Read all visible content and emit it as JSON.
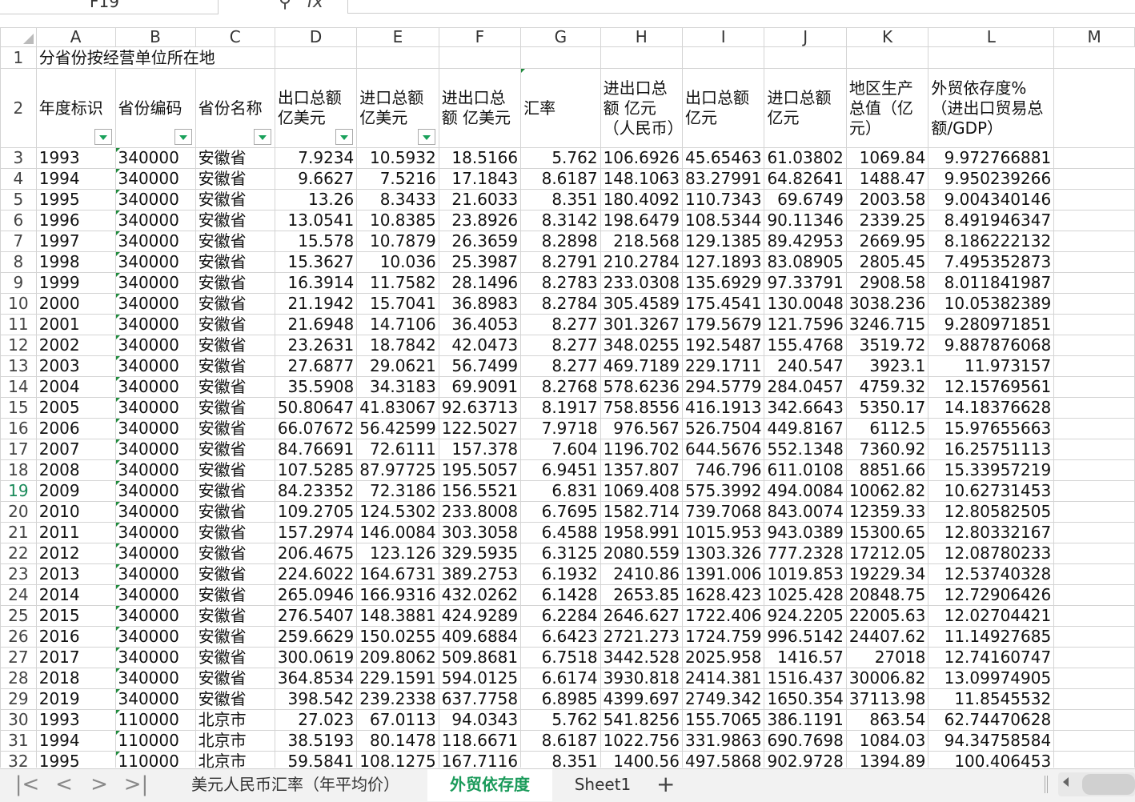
{
  "formula_bar": {
    "name_box": "F19",
    "fx": "fx",
    "content": ""
  },
  "columns": [
    "A",
    "B",
    "C",
    "D",
    "E",
    "F",
    "G",
    "H",
    "I",
    "J",
    "K",
    "L",
    "M"
  ],
  "row1": {
    "num": "1",
    "title": "分省份按经营单位所在地"
  },
  "headers": {
    "num": "2",
    "cells": [
      "年度标识",
      "省份编码",
      "省份名称",
      "出口总额 亿美元",
      "进口总额 亿美元",
      "进出口总额 亿美元",
      "汇率",
      "进出口总额 亿元（人民币）",
      "出口总额 亿元",
      "进口总额 亿元",
      "地区生产总值（亿元）",
      "外贸依存度%（进出口贸易总额/GDP）",
      ""
    ]
  },
  "rows": [
    [
      "3",
      "1993",
      "340000",
      "安徽省",
      "7.9234",
      "10.5932",
      "18.5166",
      "5.762",
      "106.6926",
      "45.65463",
      "61.03802",
      "1069.84",
      "9.972766881"
    ],
    [
      "4",
      "1994",
      "340000",
      "安徽省",
      "9.6627",
      "7.5216",
      "17.1843",
      "8.6187",
      "148.1063",
      "83.27991",
      "64.82641",
      "1488.47",
      "9.950239266"
    ],
    [
      "5",
      "1995",
      "340000",
      "安徽省",
      "13.26",
      "8.3433",
      "21.6033",
      "8.351",
      "180.4092",
      "110.7343",
      "69.6749",
      "2003.58",
      "9.004340146"
    ],
    [
      "6",
      "1996",
      "340000",
      "安徽省",
      "13.0541",
      "10.8385",
      "23.8926",
      "8.3142",
      "198.6479",
      "108.5344",
      "90.11346",
      "2339.25",
      "8.491946347"
    ],
    [
      "7",
      "1997",
      "340000",
      "安徽省",
      "15.578",
      "10.7879",
      "26.3659",
      "8.2898",
      "218.568",
      "129.1385",
      "89.42953",
      "2669.95",
      "8.186222132"
    ],
    [
      "8",
      "1998",
      "340000",
      "安徽省",
      "15.3627",
      "10.036",
      "25.3987",
      "8.2791",
      "210.2784",
      "127.1893",
      "83.08905",
      "2805.45",
      "7.495352873"
    ],
    [
      "9",
      "1999",
      "340000",
      "安徽省",
      "16.3914",
      "11.7582",
      "28.1496",
      "8.2783",
      "233.0308",
      "135.6929",
      "97.33791",
      "2908.58",
      "8.011841987"
    ],
    [
      "10",
      "2000",
      "340000",
      "安徽省",
      "21.1942",
      "15.7041",
      "36.8983",
      "8.2784",
      "305.4589",
      "175.4541",
      "130.0048",
      "3038.236",
      "10.05382389"
    ],
    [
      "11",
      "2001",
      "340000",
      "安徽省",
      "21.6948",
      "14.7106",
      "36.4053",
      "8.277",
      "301.3267",
      "179.5679",
      "121.7596",
      "3246.715",
      "9.280971851"
    ],
    [
      "12",
      "2002",
      "340000",
      "安徽省",
      "23.2631",
      "18.7842",
      "42.0473",
      "8.277",
      "348.0255",
      "192.5487",
      "155.4768",
      "3519.72",
      "9.887876068"
    ],
    [
      "13",
      "2003",
      "340000",
      "安徽省",
      "27.6877",
      "29.0621",
      "56.7499",
      "8.277",
      "469.7189",
      "229.1711",
      "240.547",
      "3923.1",
      "11.973157"
    ],
    [
      "14",
      "2004",
      "340000",
      "安徽省",
      "35.5908",
      "34.3183",
      "69.9091",
      "8.2768",
      "578.6236",
      "294.5779",
      "284.0457",
      "4759.32",
      "12.15769561"
    ],
    [
      "15",
      "2005",
      "340000",
      "安徽省",
      "50.80647",
      "41.83067",
      "92.63713",
      "8.1917",
      "758.8556",
      "416.1913",
      "342.6643",
      "5350.17",
      "14.18376628"
    ],
    [
      "16",
      "2006",
      "340000",
      "安徽省",
      "66.07672",
      "56.42599",
      "122.5027",
      "7.9718",
      "976.567",
      "526.7504",
      "449.8167",
      "6112.5",
      "15.97655663"
    ],
    [
      "17",
      "2007",
      "340000",
      "安徽省",
      "84.76691",
      "72.6111",
      "157.378",
      "7.604",
      "1196.702",
      "644.5676",
      "552.1348",
      "7360.92",
      "16.25751113"
    ],
    [
      "18",
      "2008",
      "340000",
      "安徽省",
      "107.5285",
      "87.97725",
      "195.5057",
      "6.9451",
      "1357.807",
      "746.796",
      "611.0108",
      "8851.66",
      "15.33957219"
    ],
    [
      "19",
      "2009",
      "340000",
      "安徽省",
      "84.23352",
      "72.3186",
      "156.5521",
      "6.831",
      "1069.408",
      "575.3992",
      "494.0084",
      "10062.82",
      "10.62731453"
    ],
    [
      "20",
      "2010",
      "340000",
      "安徽省",
      "109.2705",
      "124.5302",
      "233.8008",
      "6.7695",
      "1582.714",
      "739.7068",
      "843.0074",
      "12359.33",
      "12.80582505"
    ],
    [
      "21",
      "2011",
      "340000",
      "安徽省",
      "157.2974",
      "146.0084",
      "303.3058",
      "6.4588",
      "1958.991",
      "1015.953",
      "943.0389",
      "15300.65",
      "12.80332167"
    ],
    [
      "22",
      "2012",
      "340000",
      "安徽省",
      "206.4675",
      "123.126",
      "329.5935",
      "6.3125",
      "2080.559",
      "1303.326",
      "777.2328",
      "17212.05",
      "12.08780233"
    ],
    [
      "23",
      "2013",
      "340000",
      "安徽省",
      "224.6022",
      "164.6731",
      "389.2753",
      "6.1932",
      "2410.86",
      "1391.006",
      "1019.853",
      "19229.34",
      "12.53740328"
    ],
    [
      "24",
      "2014",
      "340000",
      "安徽省",
      "265.0946",
      "166.9316",
      "432.0262",
      "6.1428",
      "2653.85",
      "1628.423",
      "1025.428",
      "20848.75",
      "12.72906426"
    ],
    [
      "25",
      "2015",
      "340000",
      "安徽省",
      "276.5407",
      "148.3881",
      "424.9289",
      "6.2284",
      "2646.627",
      "1722.406",
      "924.2205",
      "22005.63",
      "12.02704421"
    ],
    [
      "26",
      "2016",
      "340000",
      "安徽省",
      "259.6629",
      "150.0255",
      "409.6884",
      "6.6423",
      "2721.273",
      "1724.759",
      "996.5142",
      "24407.62",
      "11.14927685"
    ],
    [
      "27",
      "2017",
      "340000",
      "安徽省",
      "300.0619",
      "209.8062",
      "509.8681",
      "6.7518",
      "3442.528",
      "2025.958",
      "1416.57",
      "27018",
      "12.74160747"
    ],
    [
      "28",
      "2018",
      "340000",
      "安徽省",
      "364.8534",
      "229.1591",
      "594.0125",
      "6.6174",
      "3930.818",
      "2414.381",
      "1516.437",
      "30006.82",
      "13.09974905"
    ],
    [
      "29",
      "2019",
      "340000",
      "安徽省",
      "398.542",
      "239.2338",
      "637.7758",
      "6.8985",
      "4399.697",
      "2749.342",
      "1650.354",
      "37113.98",
      "11.8545532"
    ],
    [
      "30",
      "1993",
      "110000",
      "北京市",
      "27.023",
      "67.0113",
      "94.0343",
      "5.762",
      "541.8256",
      "155.7065",
      "386.1191",
      "863.54",
      "62.74470628"
    ],
    [
      "31",
      "1994",
      "110000",
      "北京市",
      "38.5193",
      "80.1478",
      "118.6671",
      "8.6187",
      "1022.756",
      "331.9863",
      "690.7698",
      "1084.03",
      "94.34758584"
    ],
    [
      "32",
      "1995",
      "110000",
      "北京市",
      "59.5841",
      "108.1275",
      "167.7116",
      "8.351",
      "1400.56",
      "497.5868",
      "902.9728",
      "1394.89",
      "100.406453"
    ]
  ],
  "selected_row": "19",
  "tabs": [
    "美元人民币汇率（年平均价）",
    "外贸依存度",
    "Sheet1"
  ],
  "active_tab": "外贸依存度",
  "nav": {
    "first": "|<",
    "prev": "<",
    "next": ">",
    "last": ">|"
  },
  "add_sheet": "+",
  "colors": {
    "accent": "#1a9a5a",
    "filter_arrow": "#19a05a"
  }
}
